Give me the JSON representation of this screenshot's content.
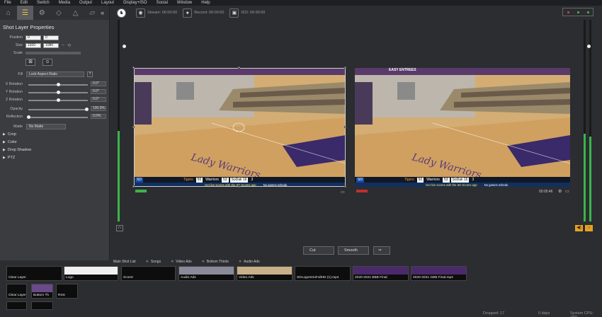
{
  "menu": [
    "File",
    "Edit",
    "Switch",
    "Media",
    "Output",
    "Layout",
    "Display+ISO",
    "Social",
    "Window",
    "Help"
  ],
  "left_panel": {
    "collapse": "«",
    "title": "Shot Layer Properties",
    "position_label": "Position",
    "position_x": "0",
    "position_y": "0",
    "size_label": "Size",
    "size_w": "1920",
    "size_h": "1080",
    "scale_label": "Scale",
    "fill_label": "Fill",
    "fill_value": "Lock Aspect Ratio",
    "x_rotation_label": "X Rotation",
    "x_rotation_value": "0.0°",
    "y_rotation_label": "Y Rotation",
    "y_rotation_value": "0.0°",
    "z_rotation_label": "Z Rotation",
    "z_rotation_value": "0.0°",
    "opacity_label": "Opacity",
    "opacity_value": "100.0%",
    "reflection_label": "Reflection",
    "reflection_value": "0.0%",
    "matte_label": "Matte",
    "matte_value": "No Matte",
    "sections": [
      "Crop",
      "Color",
      "Drop Shadow",
      "PTZ"
    ]
  },
  "toolbar": {
    "stream": "Stream: 00:00:00",
    "record": "Record: 00:00:00",
    "iso": "ISO: 00:00:00",
    "lights": [
      "#e04040",
      "#40c040",
      "#40c040"
    ]
  },
  "program": {
    "banner": "EASY ENTREES",
    "time": "00:05:46"
  },
  "scoreboard": {
    "left_code": "SD",
    "team1": "Tigers",
    "score1": "50",
    "team2": "Warriors",
    "score2": "53",
    "game_status": "SoDak 16",
    "period": "3",
    "ticker": "Get live scores with the SD Scores app",
    "ticker2": "No games schedu"
  },
  "transition": {
    "type": "Cut",
    "speed": "Smooth",
    "arrow": "⇒"
  },
  "bottom_tabs": [
    "Main Shot List",
    "Songs",
    "Video Ads",
    "Bottom Thirds",
    "Audio Ads"
  ],
  "shots_row1": [
    "Clear Layer",
    "Logo",
    "Scorer",
    "Audio Ads",
    "Video Ads",
    "SDLogoIntroFullHD (1).mp4",
    "2020-2021 BBB Final",
    "2020-2021 GBB Final.mp4"
  ],
  "shots_row2": [
    "Clear Layer",
    "Bottom Th",
    "RSS"
  ],
  "status": {
    "dropped": "Dropped: 17",
    "kbps": "0 kbps",
    "cpu": "System CPU: 46%"
  }
}
